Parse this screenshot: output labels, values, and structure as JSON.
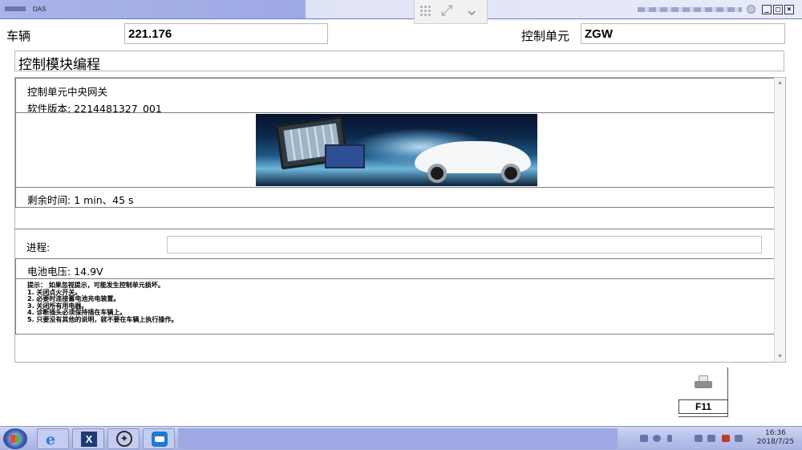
{
  "window": {
    "title": "DAS"
  },
  "header": {
    "vehicle_label": "车辆",
    "vehicle_value": "221.176",
    "ecu_label": "控制单元",
    "ecu_value": "ZGW"
  },
  "section_title": "控制模块编程",
  "module": {
    "name": "控制单元中央网关",
    "software_version": "软件版本: 2214481327_001"
  },
  "remaining_time": "剩余时间:  1 min、45 s",
  "progress": {
    "label": "进程:",
    "fraction": 0.0
  },
  "battery_voltage": "电池电压: 14.9V",
  "notes": [
    "提示：  如果忽视提示，可能发生控制单元损坏。",
    "1. 关闭点火开关。",
    "2. 必要时连接蓄电池充电装置。",
    "3. 关闭所有用电器。",
    "4. 诊断插头必须保持插在车辆上。",
    "5. 只要没有其他的说明，就不要在车辆上执行操作。"
  ],
  "function_key": {
    "label": "F11",
    "icon": "printer-icon"
  },
  "taskbar": {
    "apps": [
      "ie-icon",
      "xentry-icon",
      "mercedes-star-icon",
      "teamviewer-icon"
    ],
    "clock_time": "16:36",
    "clock_date": "2018/7/25"
  },
  "colors": {
    "titlebar": "#a9b4ea",
    "taskbar": "#b7c1ea",
    "border": "#7f7f7f"
  }
}
